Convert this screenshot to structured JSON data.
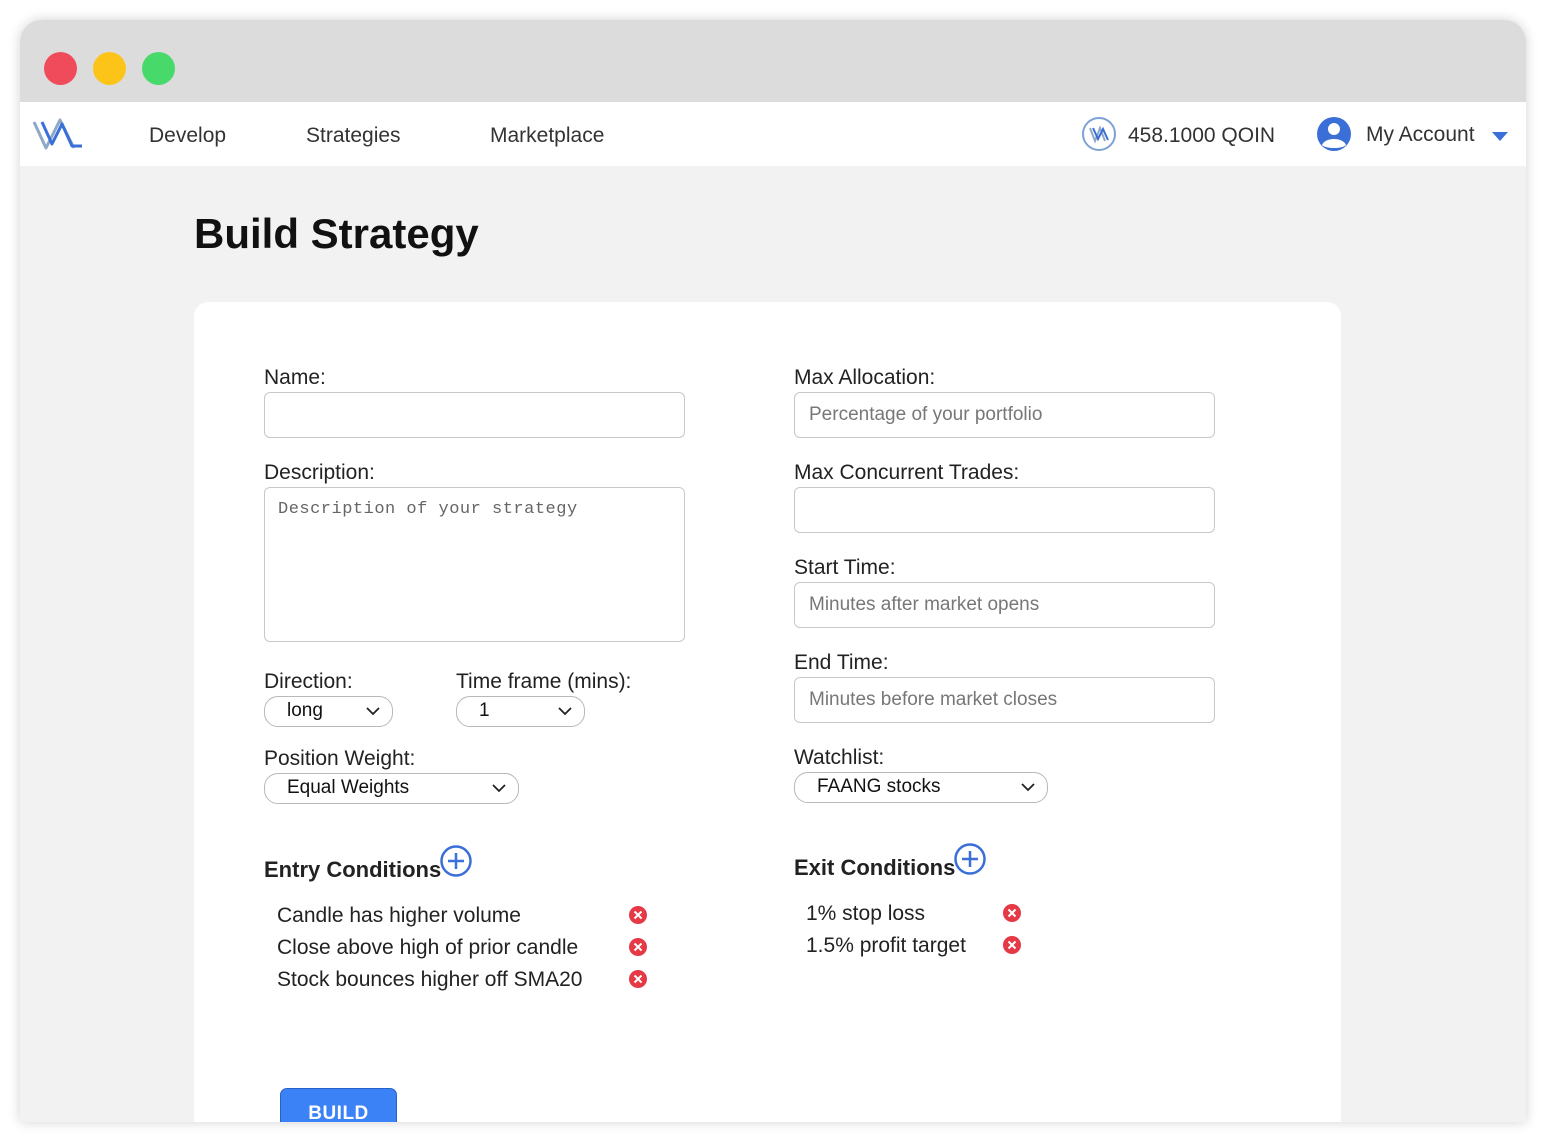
{
  "nav": {
    "links": [
      "Develop",
      "Strategies",
      "Marketplace"
    ],
    "coin_balance": "458.1000 QOIN",
    "account_label": "My Account"
  },
  "page": {
    "title": "Build Strategy"
  },
  "form": {
    "name": {
      "label": "Name:",
      "value": "",
      "placeholder": ""
    },
    "description": {
      "label": "Description:",
      "placeholder": "Description of your strategy"
    },
    "direction": {
      "label": "Direction:",
      "value": "long"
    },
    "timeframe": {
      "label": "Time frame (mins):",
      "value": "1"
    },
    "position_weight": {
      "label": "Position Weight:",
      "value": "Equal Weights"
    },
    "max_allocation": {
      "label": "Max Allocation:",
      "placeholder": "Percentage of your portfolio"
    },
    "max_concurrent": {
      "label": "Max Concurrent Trades:",
      "value": ""
    },
    "start_time": {
      "label": "Start Time:",
      "placeholder": "Minutes after market opens"
    },
    "end_time": {
      "label": "End Time:",
      "placeholder": "Minutes before market closes"
    },
    "watchlist": {
      "label": "Watchlist:",
      "value": "FAANG stocks"
    }
  },
  "entry": {
    "heading": "Entry Conditions",
    "items": [
      "Candle has higher volume",
      "Close above high of prior candle",
      "Stock bounces higher off SMA20"
    ]
  },
  "exit": {
    "heading": "Exit Conditions",
    "items": [
      "1% stop loss",
      "1.5% profit target"
    ]
  },
  "build_label": "BUILD",
  "colors": {
    "accent": "#3b82f6",
    "remove": "#e53945",
    "traffic_red": "#ef4b5a",
    "traffic_yellow": "#fcc419",
    "traffic_green": "#48d96b"
  }
}
